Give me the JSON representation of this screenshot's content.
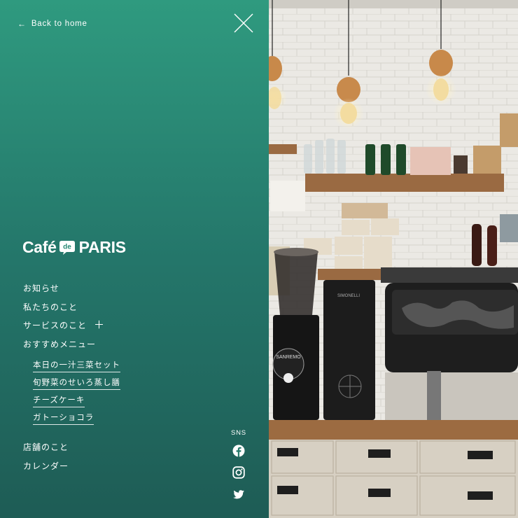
{
  "nav": {
    "back_label": "Back to home",
    "back_arrow": "←",
    "close_icon": "close-x-icon",
    "logo": {
      "part1": "Café",
      "mark": "de",
      "part2": "PARIS"
    },
    "items": [
      {
        "label": "お知らせ"
      },
      {
        "label": "私たちのこと"
      },
      {
        "label": "サービスのこと",
        "expand_icon": "＋"
      },
      {
        "label": "おすすめメニュー"
      }
    ],
    "sub_items": [
      {
        "label": "本日の一汁三菜セット"
      },
      {
        "label": "旬野菜のせいろ蒸し膳"
      },
      {
        "label": "チーズケーキ"
      },
      {
        "label": "ガトーショコラ"
      }
    ],
    "items_bottom": [
      {
        "label": "店舗のこと"
      },
      {
        "label": "カレンダー"
      }
    ],
    "sns_label": "SNS",
    "sns_icons": [
      "facebook-icon",
      "instagram-icon",
      "twitter-icon"
    ]
  },
  "photo": {
    "grinder_brand": "SANREMO",
    "grinder2_brand": "SIMONELLI"
  },
  "colors": {
    "panel_top": "#2f9a7f",
    "panel_bottom": "#1e5c55",
    "text": "#ffffff"
  }
}
